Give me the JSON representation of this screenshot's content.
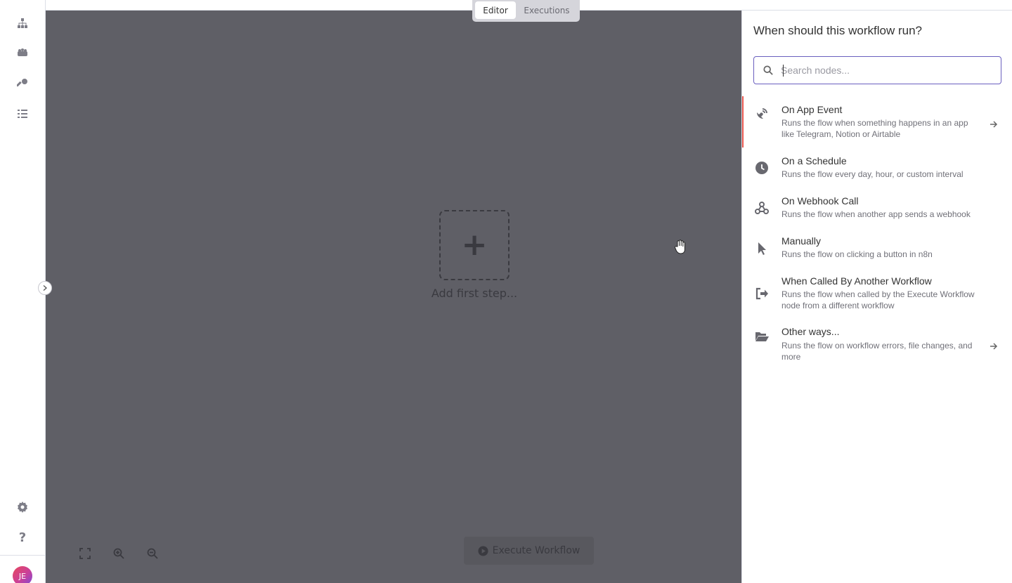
{
  "sidebar": {
    "icons": [
      "workflows-icon",
      "templates-icon",
      "credentials-icon",
      "executions-icon"
    ],
    "bottom_icons": [
      "settings-icon",
      "help-icon"
    ],
    "avatar_initials": "JE"
  },
  "tabs": {
    "editor": "Editor",
    "executions": "Executions"
  },
  "canvas": {
    "add_label": "Add first step...",
    "add_symbol": "+",
    "execute_label": "Execute Workflow"
  },
  "panel": {
    "title": "When should this workflow run?",
    "search_placeholder": "Search nodes...",
    "items": [
      {
        "title": "On App Event",
        "desc": "Runs the flow when something happens in an app like Telegram, Notion or Airtable",
        "icon": "satellite-dish-icon",
        "has_arrow": true
      },
      {
        "title": "On a Schedule",
        "desc": "Runs the flow every day, hour, or custom interval",
        "icon": "clock-icon",
        "has_arrow": false
      },
      {
        "title": "On Webhook Call",
        "desc": "Runs the flow when another app sends a webhook",
        "icon": "webhook-icon",
        "has_arrow": false
      },
      {
        "title": "Manually",
        "desc": "Runs the flow on clicking a button in n8n",
        "icon": "cursor-icon",
        "has_arrow": false
      },
      {
        "title": "When Called By Another Workflow",
        "desc": "Runs the flow when called by the Execute Workflow node from a different workflow",
        "icon": "sign-out-icon",
        "has_arrow": false
      },
      {
        "title": "Other ways...",
        "desc": "Runs the flow on workflow errors, file changes, and more",
        "icon": "folder-open-icon",
        "has_arrow": true
      }
    ]
  },
  "colors": {
    "accent": "#e8584f",
    "canvas": "#5f5f66",
    "search_border": "#6a5fbf"
  }
}
